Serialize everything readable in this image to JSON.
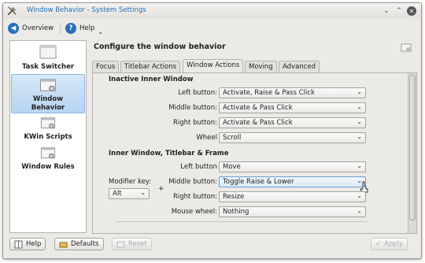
{
  "window": {
    "title": "Window Behavior - System Settings"
  },
  "toolbar": {
    "overview_label": "Overview",
    "help_label": "Help"
  },
  "sidebar": {
    "items": [
      {
        "label": "Task Switcher",
        "active": false
      },
      {
        "label": "Window Behavior",
        "active": true
      },
      {
        "label": "KWin Scripts",
        "active": false
      },
      {
        "label": "Window Rules",
        "active": false
      }
    ]
  },
  "header": {
    "title": "Configure the window behavior"
  },
  "tabs": [
    {
      "label": "Focus",
      "active": false
    },
    {
      "label": "Titlebar Actions",
      "active": false
    },
    {
      "label": "Window Actions",
      "active": true
    },
    {
      "label": "Moving",
      "active": false
    },
    {
      "label": "Advanced",
      "active": false
    }
  ],
  "inactive_inner": {
    "title": "Inactive Inner Window",
    "rows": [
      {
        "label": "Left button:",
        "value": "Activate, Raise & Pass Click"
      },
      {
        "label": "Middle button:",
        "value": "Activate & Pass Click"
      },
      {
        "label": "Right button:",
        "value": "Activate & Pass Click"
      },
      {
        "label": "Wheel",
        "value": "Scroll"
      }
    ]
  },
  "inner_titlebar_frame": {
    "title": "Inner Window, Titlebar & Frame",
    "modifier_key_label": "Modifier key:",
    "modifier_key_value": "Alt",
    "plus": "+",
    "rows": [
      {
        "label": "Left button",
        "value": "Move"
      },
      {
        "label": "Middle button:",
        "value": "Toggle Raise & Lower"
      },
      {
        "label": "Right button:",
        "value": "Resize"
      },
      {
        "label": "Mouse wheel:",
        "value": "Nothing"
      }
    ]
  },
  "bottom": {
    "help_label": "Help",
    "defaults_label": "Defaults",
    "reset_label": "Reset",
    "apply_label": "Apply"
  },
  "colors": {
    "title_text": "#1e6fb8",
    "selection": "#b7d4f1"
  }
}
